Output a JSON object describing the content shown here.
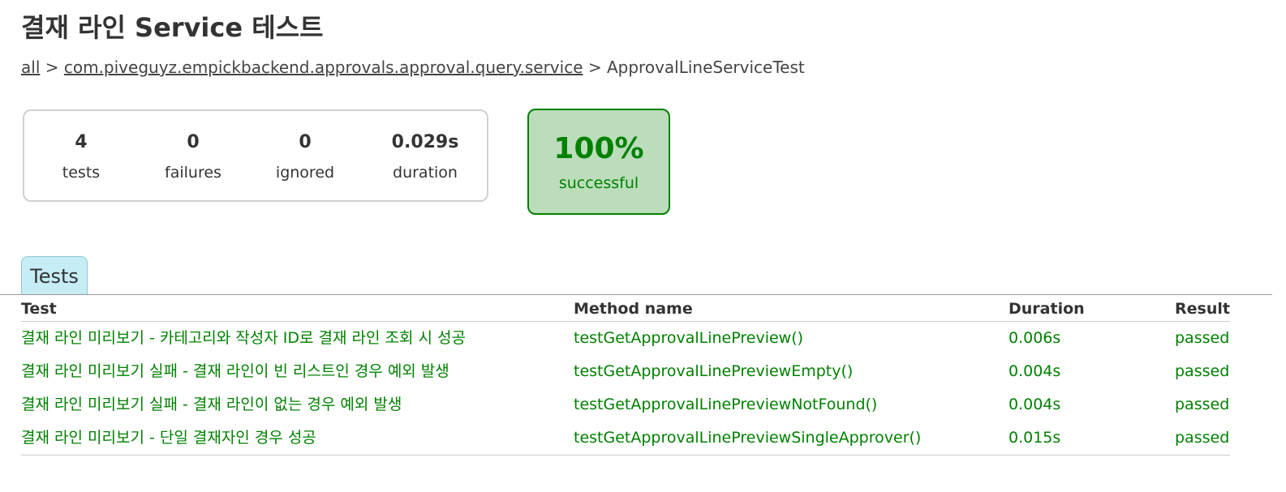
{
  "title": "결재 라인 Service 테스트",
  "breadcrumbs": {
    "all": "all",
    "sep1": " > ",
    "package": "com.piveguyz.empickbackend.approvals.approval.query.service",
    "sep2": " > ",
    "current": "ApprovalLineServiceTest"
  },
  "summary": {
    "tests": {
      "value": "4",
      "label": "tests"
    },
    "failures": {
      "value": "0",
      "label": "failures"
    },
    "ignored": {
      "value": "0",
      "label": "ignored"
    },
    "duration": {
      "value": "0.029s",
      "label": "duration"
    }
  },
  "success": {
    "percent": "100%",
    "label": "successful"
  },
  "colors": {
    "success": "#008000",
    "success_bg": "#bbddbb",
    "tab_bg": "#c6ecf5"
  },
  "tabs": {
    "tests": "Tests"
  },
  "table": {
    "headers": {
      "test": "Test",
      "method": "Method name",
      "duration": "Duration",
      "result": "Result"
    },
    "rows": [
      {
        "test": "결재 라인 미리보기 - 카테고리와 작성자 ID로 결재 라인 조회 시 성공",
        "method": "testGetApprovalLinePreview()",
        "duration": "0.006s",
        "result": "passed"
      },
      {
        "test": "결재 라인 미리보기 실패 - 결재 라인이 빈 리스트인 경우 예외 발생",
        "method": "testGetApprovalLinePreviewEmpty()",
        "duration": "0.004s",
        "result": "passed"
      },
      {
        "test": "결재 라인 미리보기 실패 - 결재 라인이 없는 경우 예외 발생",
        "method": "testGetApprovalLinePreviewNotFound()",
        "duration": "0.004s",
        "result": "passed"
      },
      {
        "test": "결재 라인 미리보기 - 단일 결재자인 경우 성공",
        "method": "testGetApprovalLinePreviewSingleApprover()",
        "duration": "0.015s",
        "result": "passed"
      }
    ]
  }
}
